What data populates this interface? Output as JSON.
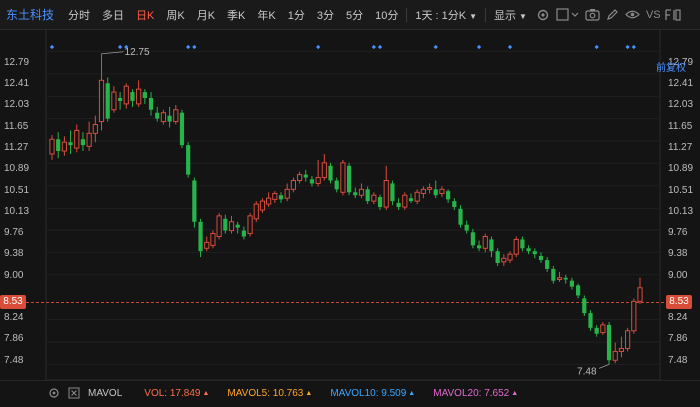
{
  "toolbar": {
    "stock_name": "东土科技",
    "periods": [
      "分时",
      "多日",
      "日K",
      "周K",
      "月K",
      "季K",
      "年K",
      "1分",
      "3分",
      "5分",
      "10分"
    ],
    "active_period": "日K",
    "combo_label": "1天 : 1分K",
    "display_label": "显示",
    "vs_label": "VS"
  },
  "restore_label": "前复权",
  "price_axis": {
    "left": [
      "12.79",
      "12.41",
      "12.03",
      "11.65",
      "11.27",
      "10.89",
      "10.51",
      "10.13",
      "9.76",
      "9.38",
      "9.00",
      "8.24",
      "7.86",
      "7.48"
    ],
    "right": [
      "12.79",
      "12.41",
      "12.03",
      "11.65",
      "11.27",
      "10.89",
      "10.51",
      "10.13",
      "9.76",
      "9.38",
      "9.00",
      "8.24",
      "7.86",
      "7.48"
    ],
    "current_left": "8.53",
    "current_right": "8.53"
  },
  "annotations": {
    "high": "12.75",
    "low": "7.48"
  },
  "indicators": {
    "name": "MAVOL",
    "vol": {
      "label": "VOL:",
      "value": "17.849"
    },
    "ma5": {
      "label": "MAVOL5:",
      "value": "10.763"
    },
    "ma10": {
      "label": "MAVOL10:",
      "value": "9.509"
    },
    "ma20": {
      "label": "MAVOL20:",
      "value": "7.652"
    }
  },
  "colors": {
    "up": "#d94c3d",
    "down": "#26b54a",
    "vol": "#ff6f4f",
    "ma5": "#ffa62b",
    "ma10": "#3aa7ff",
    "ma20": "#e36ad0",
    "accent": "#4a90ff"
  },
  "chart_data": {
    "type": "candlestick",
    "y_range": [
      7.3,
      12.95
    ],
    "current_price": 8.53,
    "candles": [
      [
        11.05,
        11.3,
        11.37,
        10.95
      ],
      [
        11.3,
        11.1,
        11.42,
        10.98
      ],
      [
        11.1,
        11.25,
        11.35,
        11.02
      ],
      [
        11.25,
        11.2,
        11.45,
        11.05
      ],
      [
        11.15,
        11.45,
        11.55,
        11.08
      ],
      [
        11.3,
        11.2,
        11.42,
        11.1
      ],
      [
        11.18,
        11.4,
        11.6,
        11.1
      ],
      [
        11.4,
        11.55,
        11.7,
        11.25
      ],
      [
        11.6,
        12.3,
        12.75,
        11.45
      ],
      [
        12.25,
        11.65,
        12.35,
        11.6
      ],
      [
        11.8,
        12.1,
        12.2,
        11.75
      ],
      [
        12.0,
        11.95,
        12.1,
        11.8
      ],
      [
        11.9,
        12.2,
        12.25,
        11.82
      ],
      [
        12.1,
        11.95,
        12.15,
        11.85
      ],
      [
        11.9,
        12.15,
        12.3,
        11.85
      ],
      [
        12.1,
        12.0,
        12.15,
        11.9
      ],
      [
        12.0,
        11.8,
        12.1,
        11.7
      ],
      [
        11.75,
        11.65,
        11.85,
        11.6
      ],
      [
        11.6,
        11.75,
        11.8,
        11.55
      ],
      [
        11.7,
        11.6,
        11.85,
        11.5
      ],
      [
        11.6,
        11.8,
        11.88,
        11.55
      ],
      [
        11.75,
        11.2,
        11.8,
        11.15
      ],
      [
        11.2,
        10.7,
        11.25,
        10.65
      ],
      [
        10.6,
        9.9,
        10.65,
        9.8
      ],
      [
        9.9,
        9.4,
        9.95,
        9.3
      ],
      [
        9.45,
        9.55,
        9.65,
        9.4
      ],
      [
        9.5,
        9.7,
        9.75,
        9.45
      ],
      [
        9.65,
        10.0,
        10.05,
        9.6
      ],
      [
        9.95,
        9.75,
        10.02,
        9.7
      ],
      [
        9.75,
        9.9,
        10.0,
        9.7
      ],
      [
        9.85,
        9.8,
        9.9,
        9.7
      ],
      [
        9.75,
        9.65,
        9.82,
        9.6
      ],
      [
        9.7,
        10.0,
        10.05,
        9.65
      ],
      [
        9.95,
        10.2,
        10.25,
        9.9
      ],
      [
        10.1,
        10.25,
        10.3,
        10.05
      ],
      [
        10.2,
        10.3,
        10.4,
        10.15
      ],
      [
        10.28,
        10.38,
        10.42,
        10.22
      ],
      [
        10.35,
        10.28,
        10.4,
        10.22
      ],
      [
        10.3,
        10.45,
        10.55,
        10.25
      ],
      [
        10.45,
        10.6,
        10.65,
        10.4
      ],
      [
        10.6,
        10.7,
        10.75,
        10.55
      ],
      [
        10.7,
        10.65,
        10.78,
        10.58
      ],
      [
        10.62,
        10.55,
        10.68,
        10.5
      ],
      [
        10.55,
        10.65,
        10.95,
        10.5
      ],
      [
        10.65,
        10.9,
        11.05,
        10.6
      ],
      [
        10.85,
        10.6,
        10.9,
        10.55
      ],
      [
        10.6,
        10.45,
        10.65,
        10.4
      ],
      [
        10.4,
        10.9,
        10.95,
        10.35
      ],
      [
        10.85,
        10.4,
        10.9,
        10.35
      ],
      [
        10.4,
        10.35,
        10.48,
        10.3
      ],
      [
        10.35,
        10.45,
        10.55,
        10.3
      ],
      [
        10.45,
        10.25,
        10.5,
        10.2
      ],
      [
        10.25,
        10.35,
        10.4,
        10.2
      ],
      [
        10.32,
        10.15,
        10.36,
        10.1
      ],
      [
        10.15,
        10.6,
        10.85,
        10.1
      ],
      [
        10.55,
        10.25,
        10.6,
        10.18
      ],
      [
        10.22,
        10.15,
        10.3,
        10.1
      ],
      [
        10.15,
        10.35,
        10.4,
        10.1
      ],
      [
        10.3,
        10.25,
        10.38,
        10.22
      ],
      [
        10.25,
        10.4,
        10.45,
        10.2
      ],
      [
        10.38,
        10.45,
        10.5,
        10.3
      ],
      [
        10.45,
        10.48,
        10.55,
        10.38
      ],
      [
        10.45,
        10.35,
        10.6,
        10.3
      ],
      [
        10.38,
        10.45,
        10.5,
        10.32
      ],
      [
        10.42,
        10.28,
        10.45,
        10.22
      ],
      [
        10.25,
        10.15,
        10.3,
        10.1
      ],
      [
        10.12,
        9.85,
        10.18,
        9.8
      ],
      [
        9.85,
        9.75,
        9.92,
        9.7
      ],
      [
        9.72,
        9.5,
        9.78,
        9.45
      ],
      [
        9.5,
        9.45,
        9.58,
        9.4
      ],
      [
        9.45,
        9.65,
        9.7,
        9.38
      ],
      [
        9.6,
        9.4,
        9.65,
        9.3
      ],
      [
        9.4,
        9.2,
        9.45,
        9.15
      ],
      [
        9.22,
        9.28,
        9.35,
        9.15
      ],
      [
        9.25,
        9.35,
        9.4,
        9.2
      ],
      [
        9.35,
        9.6,
        9.65,
        9.3
      ],
      [
        9.6,
        9.45,
        9.65,
        9.4
      ],
      [
        9.45,
        9.4,
        9.5,
        9.35
      ],
      [
        9.4,
        9.35,
        9.45,
        9.28
      ],
      [
        9.32,
        9.25,
        9.38,
        9.2
      ],
      [
        9.25,
        9.1,
        9.3,
        9.05
      ],
      [
        9.1,
        8.9,
        9.15,
        8.85
      ],
      [
        8.92,
        8.95,
        9.05,
        8.88
      ],
      [
        8.95,
        8.92,
        9.0,
        8.85
      ],
      [
        8.9,
        8.8,
        8.95,
        8.75
      ],
      [
        8.82,
        8.65,
        8.85,
        8.6
      ],
      [
        8.6,
        8.35,
        8.65,
        8.3
      ],
      [
        8.35,
        8.1,
        8.4,
        8.05
      ],
      [
        8.1,
        8.0,
        8.15,
        7.95
      ],
      [
        8.02,
        8.15,
        8.2,
        7.98
      ],
      [
        8.15,
        7.55,
        8.2,
        7.48
      ],
      [
        7.55,
        7.7,
        7.85,
        7.5
      ],
      [
        7.7,
        7.75,
        7.95,
        7.6
      ],
      [
        7.75,
        8.05,
        8.1,
        7.7
      ],
      [
        8.05,
        8.55,
        8.6,
        8.0
      ],
      [
        8.55,
        8.78,
        8.95,
        8.5
      ]
    ]
  }
}
